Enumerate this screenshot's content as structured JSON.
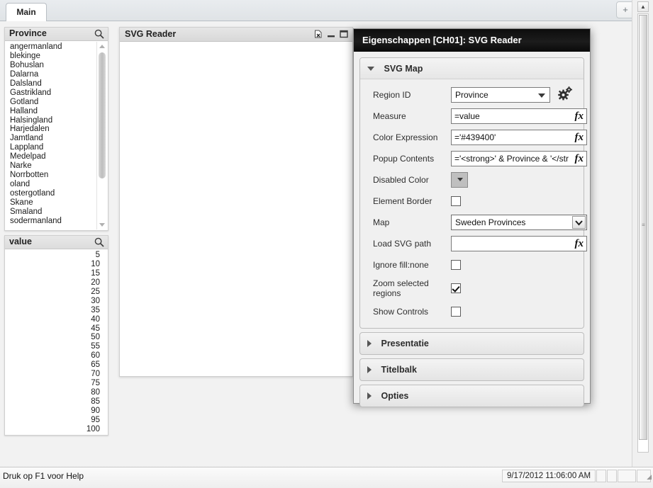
{
  "tabstrip": {
    "tabs": [
      {
        "label": "Main"
      }
    ],
    "add_label": "+"
  },
  "province_listbox": {
    "caption": "Province",
    "search_icon": "search-icon",
    "items": [
      "angermanland",
      "blekinge",
      "Bohuslan",
      "Dalarna",
      "Dalsland",
      "Gastrikland",
      "Gotland",
      "Halland",
      "Halsingland",
      "Harjedalen",
      "Jamtland",
      "Lappland",
      "Medelpad",
      "Narke",
      "Norrbotten",
      "oland",
      "ostergotland",
      "Skane",
      "Smaland",
      "sodermanland"
    ]
  },
  "value_listbox": {
    "caption": "value",
    "search_icon": "search-icon",
    "items": [
      "5",
      "10",
      "15",
      "20",
      "25",
      "30",
      "35",
      "40",
      "45",
      "50",
      "55",
      "60",
      "65",
      "70",
      "75",
      "80",
      "85",
      "90",
      "95",
      "100"
    ]
  },
  "svg_reader_object": {
    "caption": "SVG Reader",
    "icons": [
      {
        "name": "clear-selections-icon"
      },
      {
        "name": "minimize-icon"
      },
      {
        "name": "maximize-icon"
      }
    ]
  },
  "dialog": {
    "title": "Eigenschappen [CH01]: SVG Reader",
    "close_icon": "close-icon",
    "svg_map_section": {
      "title": "SVG Map",
      "expanded": true,
      "fields": {
        "region_id": {
          "label": "Region ID",
          "value": "Province",
          "gear_icon": "gear-icon"
        },
        "measure": {
          "label": "Measure",
          "value": "=value",
          "fx": "fx"
        },
        "color_expression": {
          "label": "Color Expression",
          "value": "='#439400'",
          "fx": "fx"
        },
        "popup_contents": {
          "label": "Popup Contents",
          "value": "='<strong>' & Province & '</str",
          "fx": "fx"
        },
        "disabled_color": {
          "label": "Disabled Color",
          "swatch_color": "#bfbfbf"
        },
        "element_border": {
          "label": "Element Border",
          "checked": false
        },
        "map": {
          "label": "Map",
          "value": "Sweden Provinces"
        },
        "load_svg_path": {
          "label": "Load SVG path",
          "value": "",
          "placeholder": "",
          "fx": "fx"
        },
        "ignore_fill_none": {
          "label": "Ignore fill:none",
          "checked": false
        },
        "zoom_selected_regions": {
          "label": "Zoom selected regions",
          "checked": true
        },
        "show_controls": {
          "label": "Show Controls",
          "checked": false
        }
      }
    },
    "collapsed_sections": [
      {
        "title": "Presentatie"
      },
      {
        "title": "Titelbalk"
      },
      {
        "title": "Opties"
      }
    ]
  },
  "statusbar": {
    "help_text": "Druk op F1 voor Help",
    "timestamp": "9/17/2012 11:06:00 AM"
  }
}
